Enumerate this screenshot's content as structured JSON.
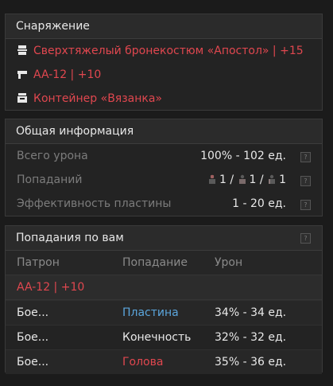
{
  "equipment": {
    "title": "Снаряжение",
    "items": [
      {
        "icon": "armor-icon",
        "label": "Сверхтяжелый бронекостюм «Апостол» | +15"
      },
      {
        "icon": "gun-icon",
        "label": "AA-12 | +10"
      },
      {
        "icon": "container-icon",
        "label": "Контейнер «Вязанка»"
      }
    ]
  },
  "general": {
    "title": "Общая информация",
    "rows": [
      {
        "label": "Всего урона",
        "value": "100% - 102 ед."
      },
      {
        "label": "Попаданий",
        "hits": [
          "1",
          "/",
          "1",
          "/",
          "1"
        ]
      },
      {
        "label": "Эффективность пластины",
        "value": "1 - 20 ед."
      }
    ],
    "help": "?"
  },
  "hits": {
    "title": "Попадания по вам",
    "columns": [
      "Патрон",
      "Попадание",
      "Урон"
    ],
    "weapon": "AA-12 | +10",
    "rows": [
      {
        "ammo": "Бое...",
        "part": "Пластина",
        "damage": "34% - 34 ед.",
        "part_color": "#5ba6dd"
      },
      {
        "ammo": "Бое...",
        "part": "Конечность",
        "damage": "32% - 32 ед.",
        "part_color": "#e8e8e8"
      },
      {
        "ammo": "Бое...",
        "part": "Голова",
        "damage": "35% - 36 ед.",
        "part_color": "#e0474f"
      }
    ],
    "help": "?"
  },
  "colors": {
    "accent_red": "#e0474f",
    "accent_blue": "#5ba6dd"
  }
}
